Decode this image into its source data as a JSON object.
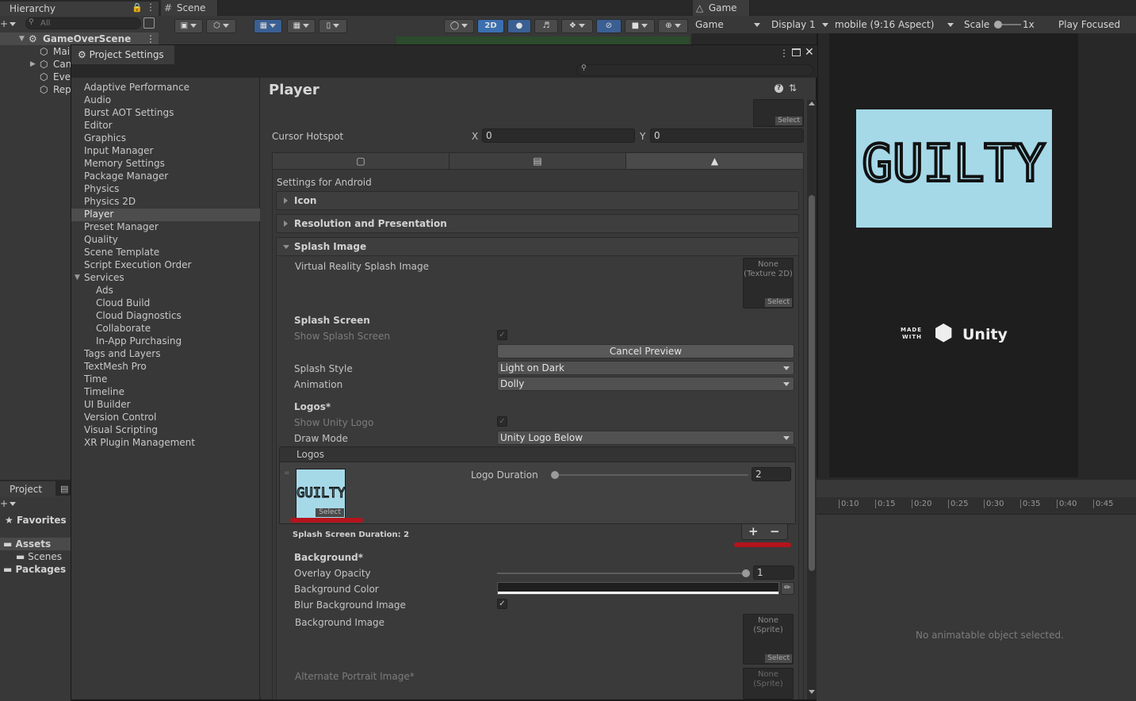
{
  "hierarchy": {
    "tab_label": "Hierarchy",
    "search_placeholder": "All",
    "scene_name": "GameOverScene",
    "items": [
      "Mai",
      "Can",
      "Eve",
      "Rep"
    ]
  },
  "scene": {
    "tab_label": "Scene",
    "btn_2d": "2D"
  },
  "game": {
    "tab_label": "Game",
    "mode": "Game",
    "display": "Display 1",
    "aspect": "mobile (9:16 Aspect)",
    "scale_label": "Scale",
    "scale_value": "1x",
    "play_mode": "Play Focused",
    "logo_text": "GUILTY",
    "made_with_line1": "MADE",
    "made_with_line2": "WITH",
    "unity_word": "Unity"
  },
  "project_panel": {
    "tab_label": "Project",
    "favorites": "Favorites",
    "assets": "Assets",
    "scenes": "Scenes",
    "packages": "Packages"
  },
  "animation": {
    "ticks": [
      "0:10",
      "0:15",
      "0:20",
      "0:25",
      "0:30",
      "0:35",
      "0:40",
      "0:45"
    ],
    "empty_message": "No animatable object selected."
  },
  "project_settings": {
    "window_title": "Project Settings",
    "categories": [
      "Adaptive Performance",
      "Audio",
      "Burst AOT Settings",
      "Editor",
      "Graphics",
      "Input Manager",
      "Memory Settings",
      "Package Manager",
      "Physics",
      "Physics 2D",
      "Player",
      "Preset Manager",
      "Quality",
      "Scene Template",
      "Script Execution Order",
      "Services"
    ],
    "services_children": [
      "Ads",
      "Cloud Build",
      "Cloud Diagnostics",
      "Collaborate",
      "In-App Purchasing"
    ],
    "categories_after": [
      "Tags and Layers",
      "TextMesh Pro",
      "Time",
      "Timeline",
      "UI Builder",
      "Version Control",
      "Visual Scripting",
      "XR Plugin Management"
    ],
    "selected_category": "Player",
    "player": {
      "title": "Player",
      "select_label": "Select",
      "cursor_hotspot_label": "Cursor Hotspot",
      "hotspot_x_label": "X",
      "hotspot_x": "0",
      "hotspot_y_label": "Y",
      "hotspot_y": "0",
      "settings_for": "Settings for Android",
      "foldouts": {
        "icon": "Icon",
        "resolution": "Resolution and Presentation",
        "splash": "Splash Image"
      },
      "vr_splash_label": "Virtual Reality Splash Image",
      "vr_splash_value_line1": "None",
      "vr_splash_value_line2": "(Texture 2D)",
      "splash_screen_header": "Splash Screen",
      "show_splash_label": "Show Splash Screen",
      "cancel_preview": "Cancel Preview",
      "splash_style_label": "Splash Style",
      "splash_style_value": "Light on Dark",
      "animation_label": "Animation",
      "animation_value": "Dolly",
      "logos_header": "Logos*",
      "show_unity_logo_label": "Show Unity Logo",
      "draw_mode_label": "Draw Mode",
      "draw_mode_value": "Unity Logo Below",
      "logos_list_header": "Logos",
      "logo_duration_label": "Logo Duration",
      "logo_duration_value": "2",
      "logo_duration_fraction": 0.0,
      "logo_thumb_text": "GUILTY",
      "splash_duration": "Splash Screen Duration: 2",
      "add_symbol": "+",
      "remove_symbol": "−",
      "background_header": "Background*",
      "overlay_opacity_label": "Overlay Opacity",
      "overlay_opacity_value": "1",
      "overlay_opacity_fraction": 1.0,
      "background_color_label": "Background Color",
      "background_color": "#1e1e1e",
      "blur_bg_label": "Blur Background Image",
      "bg_image_label": "Background Image",
      "bg_image_value_line1": "None",
      "bg_image_value_line2": "(Sprite)",
      "alt_portrait_label": "Alternate Portrait Image*",
      "alt_portrait_value_line1": "None",
      "alt_portrait_value_line2": "(Sprite)"
    }
  },
  "colors": {
    "logo_bg": "#a6d9e8",
    "annotation_red": "#b4141c",
    "accent_blue": "#3b6fb0"
  }
}
